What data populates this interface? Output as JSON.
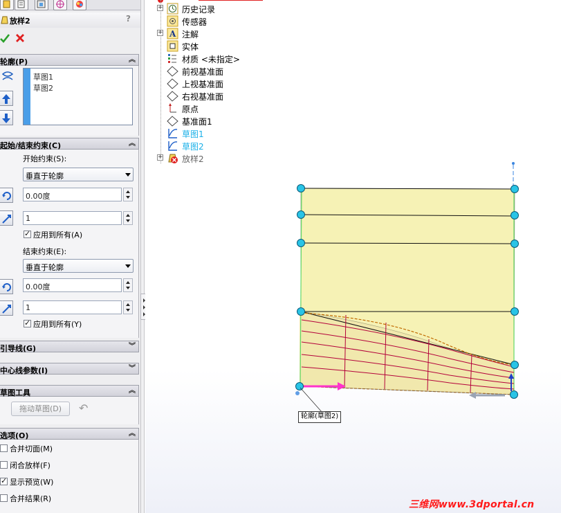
{
  "property_manager": {
    "title": "放样2",
    "help": "?",
    "profile_group": {
      "header": "轮廓(P)",
      "items": [
        "草图1",
        "草图2"
      ]
    },
    "constraints_group": {
      "header": "起始/结束约束(C)",
      "start_label": "开始约束(S):",
      "start_value": "垂直于轮廓",
      "start_angle": "0.00度",
      "start_length": "1",
      "start_apply_all": "应用到所有(A)",
      "end_label": "结束约束(E):",
      "end_value": "垂直于轮廓",
      "end_angle": "0.00度",
      "end_length": "1",
      "end_apply_all": "应用到所有(Y)"
    },
    "guides_header": "引导线(G)",
    "centerline_header": "中心线参数(I)",
    "sketch_tools": {
      "header": "草图工具",
      "drag_button": "拖动草图(D)"
    },
    "options": {
      "header": "选项(O)",
      "merge_tangent": "合并切面(M)",
      "close_loft": "闭合放样(F)",
      "show_preview": "显示预览(W)",
      "merge_result": "合并结果(R)"
    }
  },
  "feature_tree": [
    {
      "label": "历史记录",
      "icon": "history-icon",
      "expandable": true
    },
    {
      "label": "传感器",
      "icon": "sensor-icon",
      "expandable": false
    },
    {
      "label": "注解",
      "icon": "annotation-icon",
      "expandable": true
    },
    {
      "label": "实体",
      "icon": "solid-bodies-icon",
      "expandable": false
    },
    {
      "label": "材质 <未指定>",
      "icon": "material-icon",
      "expandable": false
    },
    {
      "label": "前视基准面",
      "icon": "plane-icon",
      "expandable": false
    },
    {
      "label": "上视基准面",
      "icon": "plane-icon",
      "expandable": false
    },
    {
      "label": "右视基准面",
      "icon": "plane-icon",
      "expandable": false
    },
    {
      "label": "原点",
      "icon": "origin-icon",
      "expandable": false
    },
    {
      "label": "基准面1",
      "icon": "plane-icon",
      "expandable": false
    },
    {
      "label": "草图1",
      "icon": "sketch-icon",
      "expandable": false,
      "highlight": true
    },
    {
      "label": "草图2",
      "icon": "sketch-icon",
      "expandable": false,
      "highlight": true
    },
    {
      "label": "放样2",
      "icon": "loft-error-icon",
      "expandable": true
    }
  ],
  "graphics": {
    "callout": "轮廓(草图2)",
    "watermark": "三维网www.3dportal.cn"
  },
  "colors": {
    "preview_fill": "#f5f0a8",
    "handle": "#29c4e6",
    "highlight_text": "#1ab0e8",
    "connector": "#b3003a",
    "arrow": "#ff33cc",
    "watermark": "#ff1a1a"
  }
}
